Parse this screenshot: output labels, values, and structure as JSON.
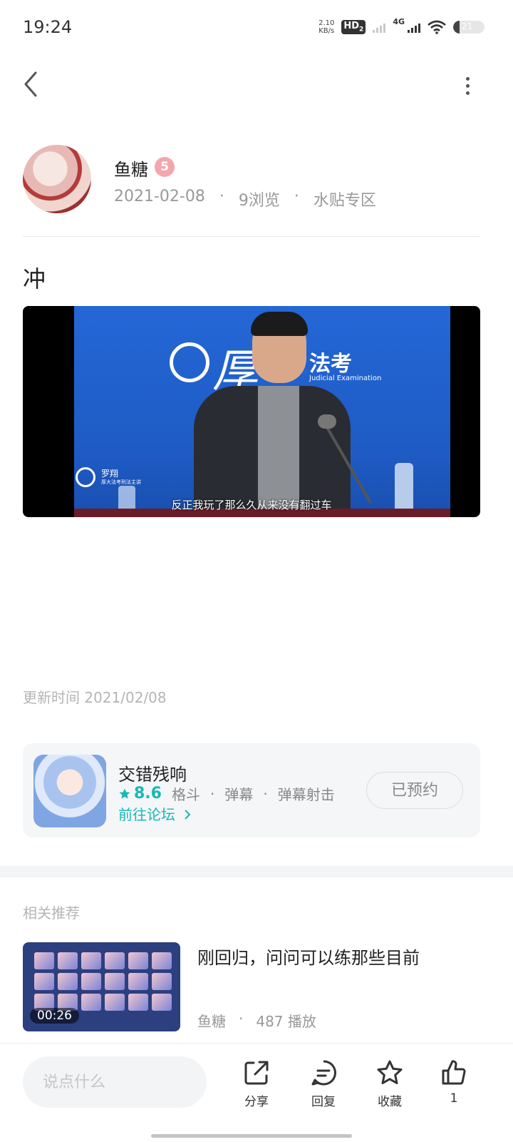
{
  "status_bar": {
    "time": "19:24",
    "net_speed_value": "2.10",
    "net_speed_unit": "KB/s",
    "hd_label": "HD",
    "hd_sub": "2",
    "network_label": "4G",
    "battery_percent": "21"
  },
  "post": {
    "author_name": "鱼糖",
    "author_badge": "5",
    "date": "2021-02-08",
    "views": "9浏览",
    "board": "水贴专区",
    "separator": "·",
    "title": "冲",
    "update_time": "更新时间 2021/02/08"
  },
  "video": {
    "logo_char": "厚",
    "logo_text": "法考",
    "logo_sub": "Judicial Examination",
    "lecturer_name": "罗翔",
    "lecturer_title": "厚大法考刑法主讲",
    "subtitle": "反正我玩了那么久从来没有翻过车"
  },
  "game_card": {
    "name": "交错残响",
    "rating": "8.6",
    "tags": [
      "格斗",
      "弹幕",
      "弹幕射击"
    ],
    "forum_link": "前往论坛",
    "reserve_label": "已预约"
  },
  "related": {
    "section_label": "相关推荐",
    "items": [
      {
        "title": "刚回归，问问可以练那些目前",
        "author": "鱼糖",
        "plays": "487 播放",
        "duration": "00:26"
      }
    ]
  },
  "bottom_bar": {
    "comment_placeholder": "说点什么",
    "share_label": "分享",
    "reply_label": "回复",
    "favorite_label": "收藏",
    "like_count": "1"
  },
  "colors": {
    "accent_teal": "#17b8b5",
    "muted_text": "#999999",
    "video_blue": "#2467d6"
  },
  "icons": [
    "back-icon",
    "more-icon",
    "star-icon",
    "chevron-right-icon",
    "share-icon",
    "reply-icon",
    "favorite-icon",
    "like-icon"
  ]
}
